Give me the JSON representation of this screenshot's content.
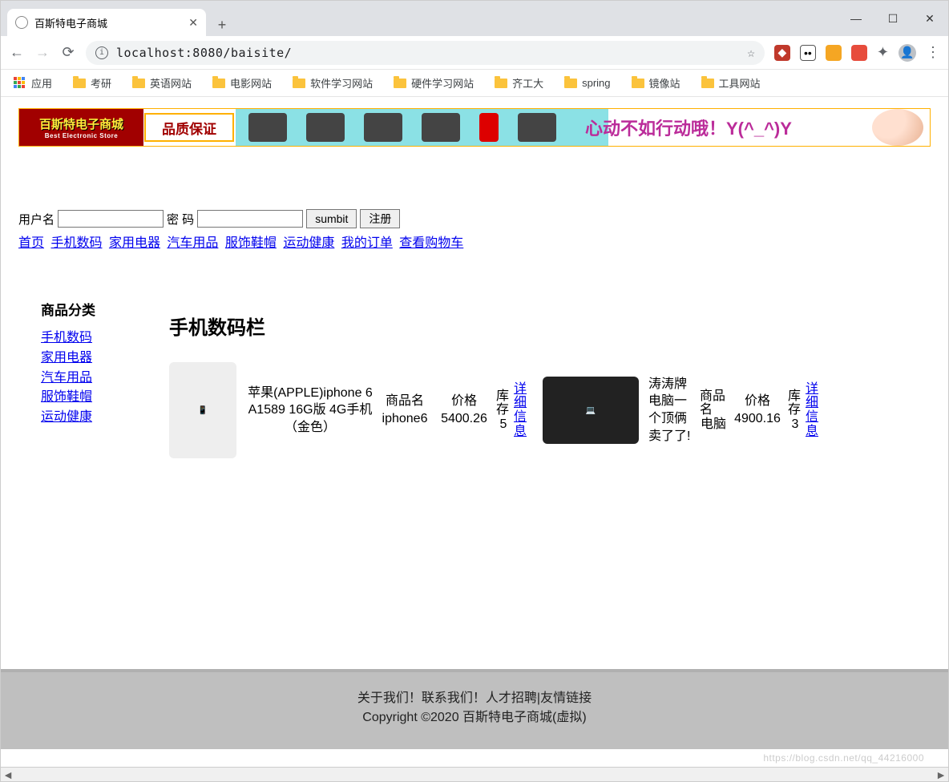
{
  "browser": {
    "tab_title": "百斯特电子商城",
    "url": "localhost:8080/baisite/",
    "apps_label": "应用",
    "bookmarks": [
      "考研",
      "英语网站",
      "电影网站",
      "软件学习网站",
      "硬件学习网站",
      "齐工大",
      "spring",
      "镜像站",
      "工具网站"
    ]
  },
  "banner": {
    "logo_cn": "百斯特电子商城",
    "logo_en": "Best Electronic Store",
    "quality": "品质保证",
    "slogan": "心动不如行动哦！Y(^_^)Y"
  },
  "login": {
    "user_label": "用户名",
    "pass_label": "密 码",
    "submit": "sumbit",
    "register": "注册"
  },
  "nav": [
    "首页",
    "手机数码",
    "家用电器",
    "汽车用品",
    "服饰鞋帽",
    "运动健康",
    "我的订单",
    "查看购物车"
  ],
  "sidebar": {
    "title": "商品分类",
    "items": [
      "手机数码",
      "家用电器",
      "汽车用品",
      "服饰鞋帽",
      "运动健康"
    ]
  },
  "section_title": "手机数码栏",
  "labels": {
    "name_prefix": "商品名",
    "price_prefix": "价格",
    "stock_prefix": "库存",
    "detail": "详细信息"
  },
  "products": [
    {
      "desc": "苹果(APPLE)iphone 6 A1589 16G版 4G手机（金色）",
      "name": "iphone6",
      "price": "5400.26",
      "stock": "5",
      "img": "phone"
    },
    {
      "desc": "涛涛牌电脑一个顶俩卖了了!",
      "name": "电脑",
      "price": "4900.16",
      "stock": "3",
      "img": "laptop"
    }
  ],
  "footer": {
    "links": "关于我们！联系我们！人才招聘|友情链接",
    "copyright": "Copyright ©2020 百斯特电子商城(虚拟)"
  },
  "watermark": "https://blog.csdn.net/qq_44216000"
}
